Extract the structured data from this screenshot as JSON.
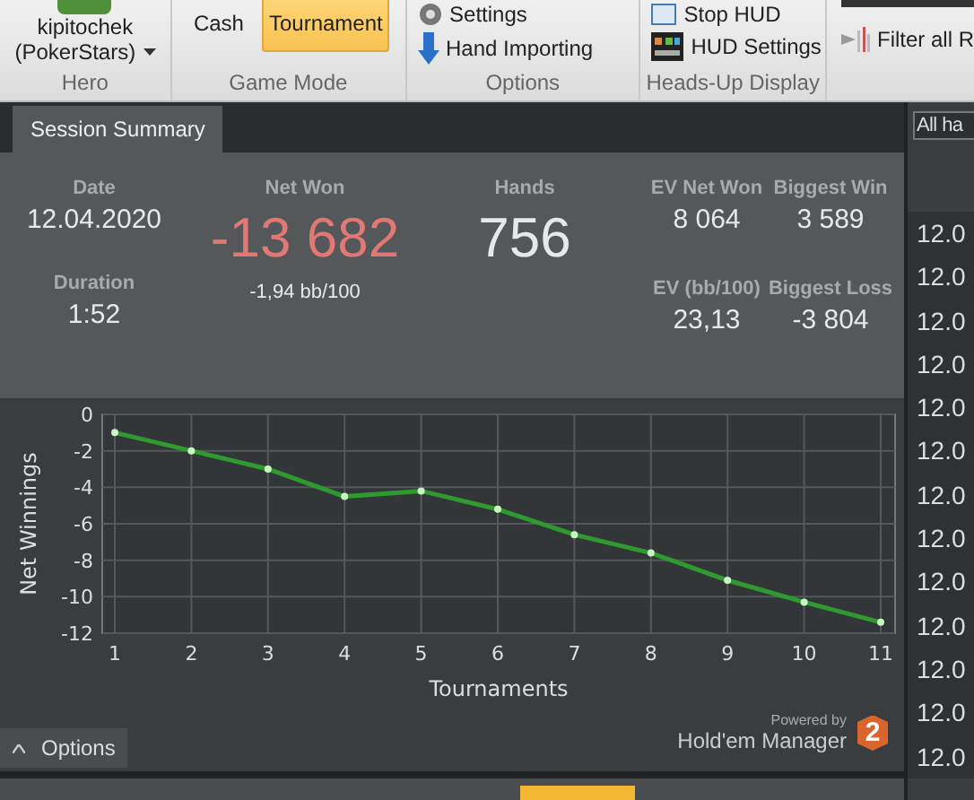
{
  "ribbon": {
    "hero": {
      "name": "kipitochek",
      "site": "(PokerStars)",
      "group_label": "Hero"
    },
    "game_mode": {
      "group_label": "Game Mode",
      "modes": [
        {
          "label": "Cash",
          "selected": false
        },
        {
          "label": "Tournament",
          "selected": true
        }
      ]
    },
    "options": {
      "group_label": "Options",
      "items": [
        "Settings",
        "Hand Importing"
      ]
    },
    "hud": {
      "group_label": "Heads-Up Display",
      "items": [
        "Stop HUD",
        "HUD Settings"
      ]
    },
    "filter_button": "Filter all R"
  },
  "tabs": [
    {
      "label": "Session Summary",
      "selected": true
    }
  ],
  "summary": {
    "date": {
      "label": "Date",
      "value": "12.04.2020"
    },
    "duration": {
      "label": "Duration",
      "value": "1:52"
    },
    "net_won": {
      "label": "Net Won",
      "value": "-13 682",
      "rate": "-1,94 bb/100"
    },
    "hands": {
      "label": "Hands",
      "value": "756"
    },
    "ev_net_won": {
      "label": "EV Net Won",
      "value": "8 064"
    },
    "biggest_win": {
      "label": "Biggest Win",
      "value": "3 589"
    },
    "ev_bb": {
      "label": "EV (bb/100)",
      "value": "23,13"
    },
    "biggest_loss": {
      "label": "Biggest Loss",
      "value": "-3 804"
    }
  },
  "chart": {
    "chart_data": {
      "type": "line",
      "xlabel": "Tournaments",
      "ylabel": "Net Winnings",
      "x": [
        1,
        2,
        3,
        4,
        5,
        6,
        7,
        8,
        9,
        10,
        11
      ],
      "series": [
        {
          "color": "#2f9a2f",
          "marker": true,
          "values": [
            -1.0,
            -2.0,
            -3.0,
            -4.5,
            -4.2,
            -5.2,
            -6.6,
            -7.6,
            -9.1,
            -10.3,
            -11.4
          ]
        }
      ],
      "grid": true,
      "xlim": [
        1,
        11
      ],
      "ylim": [
        -12,
        0
      ],
      "xticks": [
        1,
        2,
        3,
        4,
        5,
        6,
        7,
        8,
        9,
        10,
        11
      ],
      "yticks": [
        0,
        -2,
        -4,
        -6,
        -8,
        -10,
        -12
      ]
    }
  },
  "options_button": "Options",
  "powered_by": {
    "caption": "Powered by",
    "product": "Hold'em Manager",
    "badge": "2"
  },
  "side": {
    "dropdown": "All ha",
    "rows": [
      "12.0",
      "12.0",
      "12.0",
      "12.0",
      "12.0",
      "12.0",
      "12.0",
      "12.0",
      "12.0",
      "12.0",
      "12.0",
      "12.0",
      "12.0"
    ]
  }
}
